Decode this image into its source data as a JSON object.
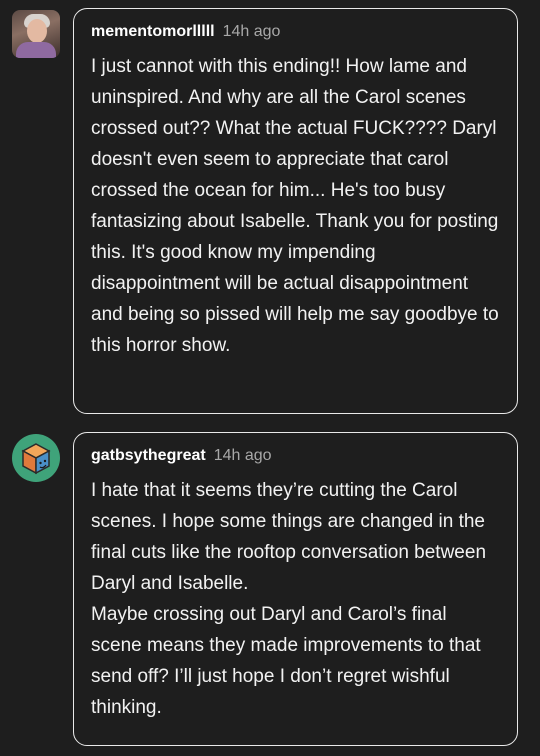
{
  "comments": [
    {
      "username": "mementomorlllll",
      "time": "14h ago",
      "avatar_icon": "user-photo-avatar",
      "paragraphs": [
        "I just cannot with this ending!! How lame and uninspired. And why are all the Carol scenes crossed out?? What the actual FUCK???? Daryl doesn't even seem to appreciate that carol crossed the ocean for him... He's too busy fantasizing about Isabelle. Thank you for posting this. It's good know my impending disappointment will be actual disappointment and being so pissed will help me say goodbye to this horror show."
      ]
    },
    {
      "username": "gatbsythegreat",
      "time": "14h ago",
      "avatar_icon": "cube-avatar",
      "paragraphs": [
        "I hate that it seems they’re cutting the Carol scenes. I hope some things are changed in the final cuts like the rooftop conversation between Daryl and Isabelle.",
        "Maybe crossing out Daryl and Carol’s final scene means they made improvements to that send off? I’ll just hope I don’t regret wishful thinking."
      ]
    }
  ],
  "colors": {
    "background": "#1e1e1e",
    "bubble_border": "#e9e9e9",
    "text": "#f2f2f2",
    "timestamp": "#a8a8a8",
    "avatar_green": "#3fa37a"
  }
}
